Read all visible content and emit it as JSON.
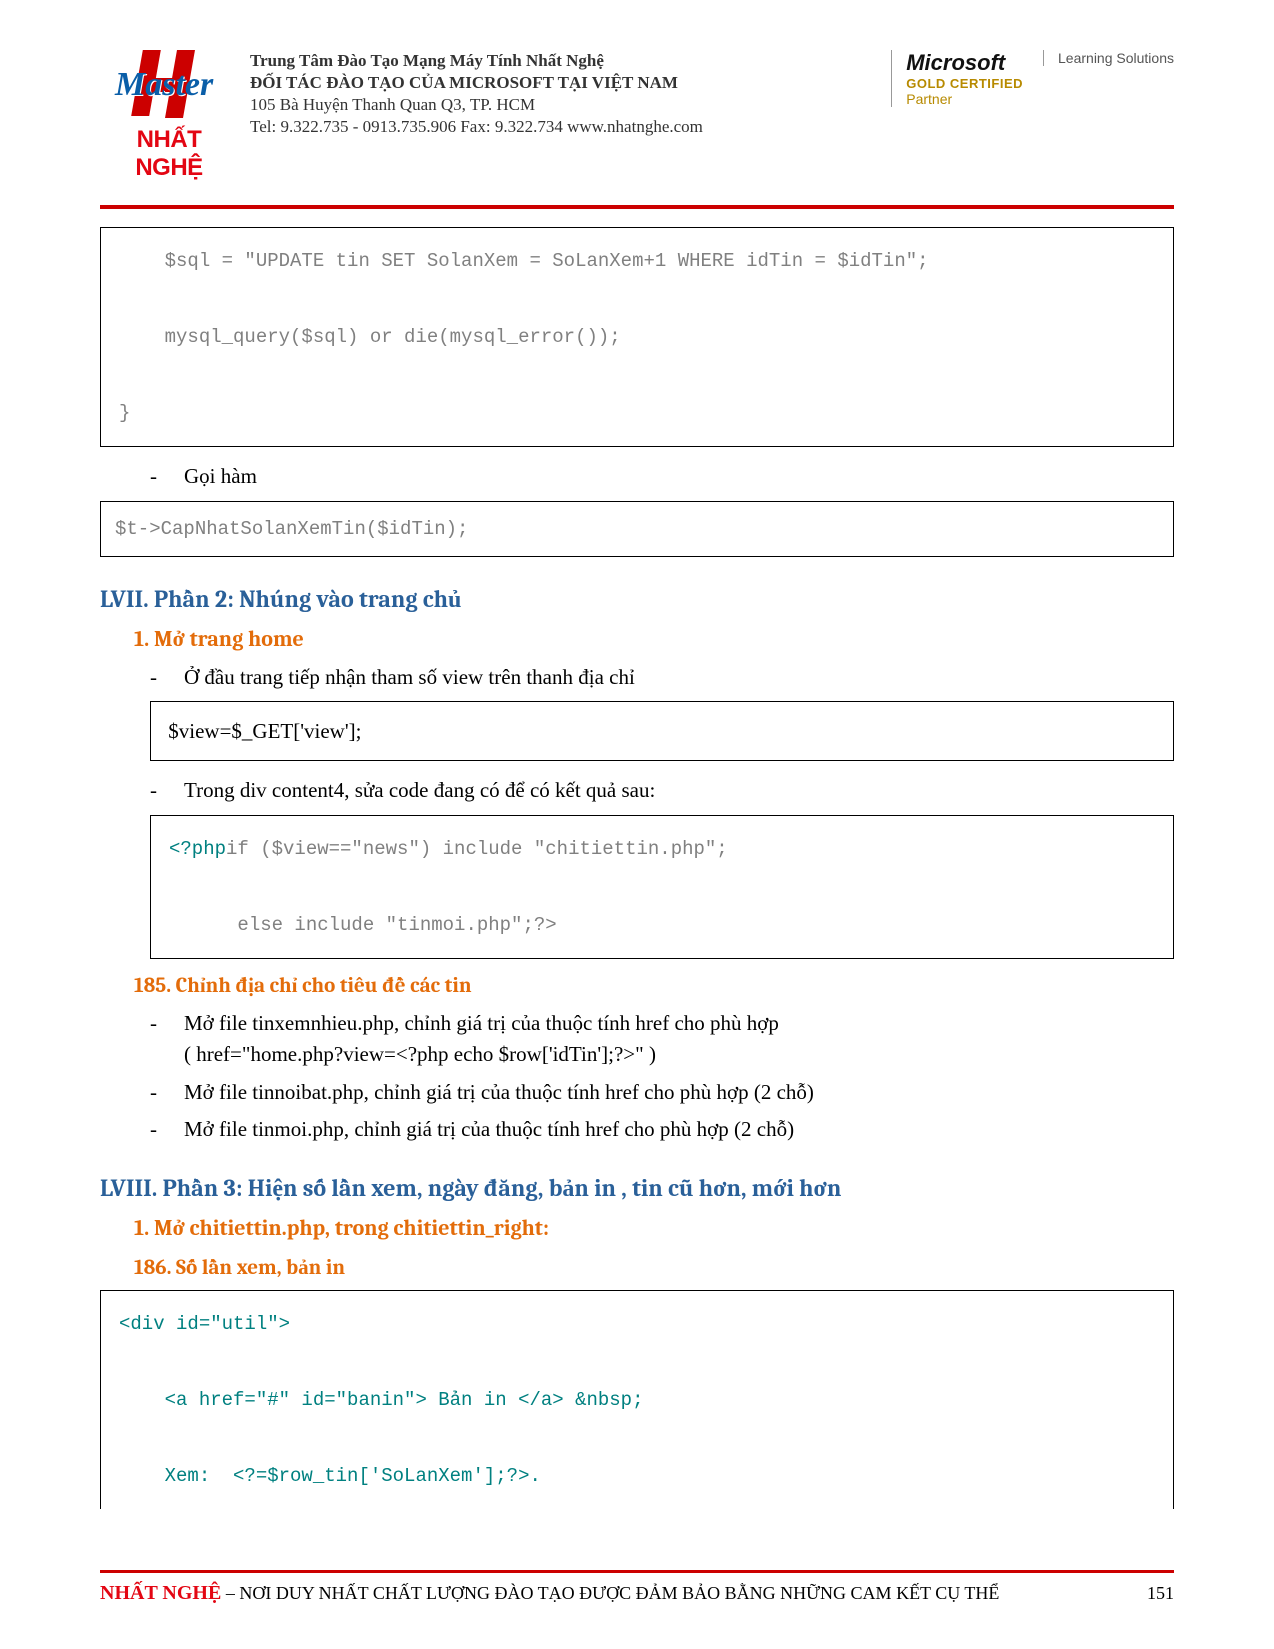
{
  "header": {
    "brand_text": "NHẤT NGHỆ",
    "org": {
      "line1": "Trung Tâm Đào Tạo Mạng Máy Tính Nhất Nghệ",
      "line2": "ĐỐI TÁC ĐÀO TẠO CỦA MICROSOFT TẠI VIỆT NAM",
      "line3": "105 Bà Huyện Thanh Quan  Q3, TP. HCM",
      "line4": "Tel:  9.322.735 - 0913.735.906 Fax:  9.322.734 www.nhatnghe.com"
    },
    "cert": {
      "microsoft": "Microsoft",
      "gold": "GOLD CERTIFIED",
      "partner": "Partner",
      "learning": "Learning Solutions"
    }
  },
  "code1": "    $sql = \"UPDATE tin SET SolanXem = SoLanXem+1 WHERE idTin = $idTin\";\n\n    mysql_query($sql) or die(mysql_error());\n\n}",
  "bullet1": "Gọi hàm",
  "code2": "$t->CapNhatSolanXemTin($idTin);",
  "section_lvii": "LVII. Phần 2: Nhúng vào trang chủ",
  "sub1": "1. Mở trang home",
  "bullet2": "Ở đầu trang tiếp nhận tham số view  trên thanh địa chỉ",
  "code3": " $view=$_GET['view'];",
  "bullet3": "Trong div content4, sửa code đang có để có kết quả sau:",
  "code4_prefix": "<?php",
  "code4_rest": "if ($view==\"news\") include \"chitiettin.php\";\n\n      else include \"tinmoi.php\";?>",
  "sub185": "185. Chỉnh địa chỉ cho tiêu đề các tin",
  "bullet4a": "Mở file tinxemnhieu.php, chỉnh giá trị của thuộc tính href cho phù hợp",
  "bullet4b": "(  href=\"home.php?view=<?php echo $row['idTin'];?>\"  )",
  "bullet5": "Mở file tinnoibat.php, chỉnh giá trị của thuộc tính href cho phù hợp (2 chỗ)",
  "bullet6": "Mở file tinmoi.php, chỉnh giá trị của thuộc tính href cho phù hợp (2 chỗ)",
  "section_lviii": "LVIII. Phần 3:  Hiện số lần xem, ngày đăng, bản in , tin cũ hơn, mới hơn",
  "sub2": "1. Mở chitiettin.php, trong chitiettin_right:",
  "sub186": "186. Số lần xem, bản in",
  "code5": "<div id=\"util\">\n\n    <a href=\"#\" id=\"banin\"> Bản in </a> &nbsp;\n\n    Xem:  <?=$row_tin['SoLanXem'];?>.",
  "footer": {
    "brand": "NHẤT NGHỆ",
    "slogan": " – NƠI DUY NHẤT CHẤT LƯỢNG ĐÀO TẠO ĐƯỢC ĐẢM BẢO BẰNG NHỮNG CAM KẾT CỤ THỂ",
    "page": "151"
  }
}
